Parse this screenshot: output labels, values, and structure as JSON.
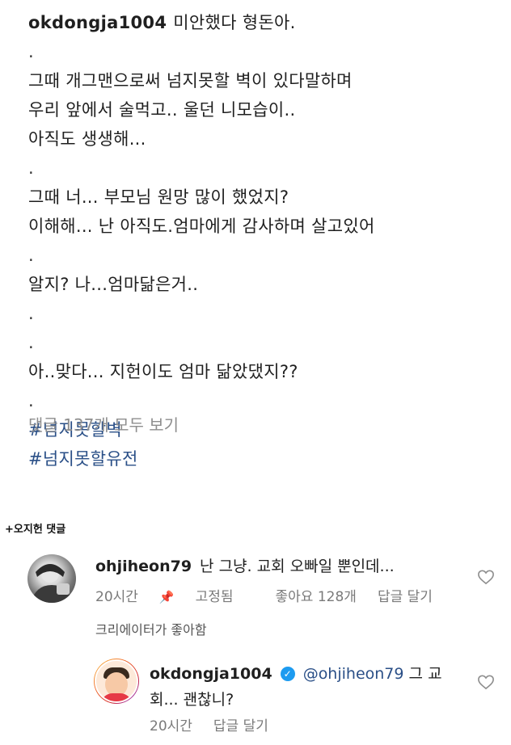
{
  "caption": {
    "username": "okdongja1004",
    "lines": [
      "미안했다 형돈아.",
      ".",
      "그때 개그맨으로써 넘지못할 벽이 있다말하며",
      "우리 앞에서 술먹고.. 울던 니모습이..",
      "아직도 생생해...",
      ".",
      "그때 너... 부모님 원망 많이 했었지?",
      "이해해... 난 아직도.엄마에게 감사하며 살고있어",
      ".",
      "알지? 나...엄마닮은거..",
      ".",
      ".",
      "아..맞다... 지헌이도 엄마 닮았댔지??",
      "."
    ],
    "hashtags": [
      "#넘지못할벽",
      "#넘지못할유전"
    ],
    "view_comments": "댓글 137개 모두 보기"
  },
  "note": "+오지헌 댓글",
  "comment1": {
    "username": "ohjiheon79",
    "text": "난 그냥.  교회 오빠일 뿐인데...",
    "time": "20시간",
    "pinned": "고정됨",
    "likes": "좋아요 128개",
    "reply": "답글 달기",
    "creator_liked": "크리에이터가 좋아함"
  },
  "reply1": {
    "username": "okdongja1004",
    "mention": "@ohjiheon79",
    "text_part1": "그 교",
    "text_part2": "회... 괜찮니?",
    "time": "20시간",
    "reply": "답글 달기"
  },
  "colors": {
    "hashtag": "#2a4f87",
    "meta": "#7a7a7a",
    "verified": "#1d9bf0"
  }
}
